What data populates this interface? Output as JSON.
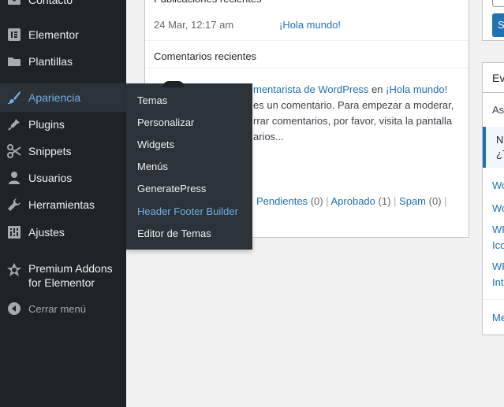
{
  "sidebar": {
    "items": [
      {
        "label": "Contacto",
        "icon": "mail-icon"
      },
      {
        "label": "Elementor",
        "icon": "elementor-icon"
      },
      {
        "label": "Plantillas",
        "icon": "folder-icon"
      },
      {
        "label": "Apariencia",
        "icon": "paintbrush-icon"
      },
      {
        "label": "Plugins",
        "icon": "plugin-icon"
      },
      {
        "label": "Snippets",
        "icon": "scissors-icon"
      },
      {
        "label": "Usuarios",
        "icon": "user-icon"
      },
      {
        "label": "Herramientas",
        "icon": "wrench-icon"
      },
      {
        "label": "Ajustes",
        "icon": "settings-icon"
      },
      {
        "label": "Premium Addons\nfor Elementor",
        "icon": "badge-icon"
      },
      {
        "label": "Cerrar menú",
        "icon": "collapse-arrow-icon"
      }
    ]
  },
  "flyout": {
    "items": [
      "Temas",
      "Personalizar",
      "Widgets",
      "Menús",
      "GeneratePress",
      "Header Footer Builder",
      "Editor de Temas"
    ]
  },
  "activity": {
    "posts_heading": "Publicaciones recientes",
    "post_date": "24 Mar, 12:17 am",
    "post_title": "¡Hola mundo!",
    "comments_heading": "Comentarios recientes",
    "comment_author": "mentarista de WordPress",
    "comment_in": "en",
    "comment_post": "¡Hola mundo!",
    "comment_line1": "es un comentario. Para empezar a moderar,",
    "comment_line2": "rrar comentarios, por favor, visita la pantalla",
    "comment_line3": "arios...",
    "filters": {
      "pending": "Pendientes",
      "pending_count": "(0)",
      "approved": "Aprobado",
      "approved_count": "(1)",
      "spam": "Spam",
      "spam_count": "(0)",
      "separator": "|"
    }
  },
  "events": {
    "heading": "Eve",
    "subtitle": "As",
    "highlight_line1": "N",
    "highlight_line2": "¿T",
    "news": [
      "Wo",
      "Wo",
      "WP",
      "Ico",
      "WP",
      "Int",
      "Me"
    ],
    "button": "S"
  },
  "colors": {
    "sidebar_bg": "#1d2327",
    "submenu_bg": "#2c3338",
    "accent": "#72aee6",
    "link": "#2271b1",
    "button": "#2271b1"
  }
}
